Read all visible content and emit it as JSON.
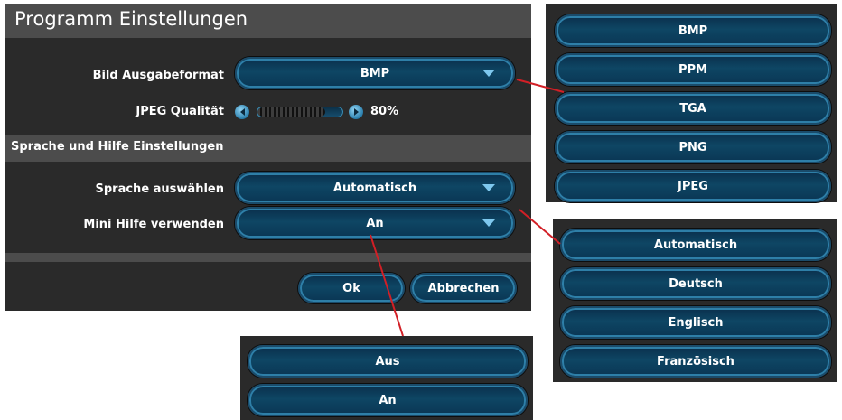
{
  "dialog": {
    "title": "Programm Einstellungen",
    "image_output_label": "Bild Ausgabeformat",
    "image_output_value": "BMP",
    "jpeg_quality_label": "JPEG Qualität",
    "jpeg_quality_value": "80%",
    "jpeg_quality_fraction": 0.8,
    "section_title": "Sprache und Hilfe Einstellungen",
    "language_label": "Sprache auswählen",
    "language_value": "Automatisch",
    "mini_help_label": "Mini Hilfe verwenden",
    "mini_help_value": "An",
    "ok_label": "Ok",
    "cancel_label": "Abbrechen"
  },
  "format_options": [
    "BMP",
    "PPM",
    "TGA",
    "PNG",
    "JPEG"
  ],
  "language_options": [
    "Automatisch",
    "Deutsch",
    "Englisch",
    "Französisch"
  ],
  "help_options": [
    "Aus",
    "An"
  ],
  "colors": {
    "panel_bg": "#2a2a2a",
    "header_bg": "#4c4c4c",
    "button_fill": "#0e4664",
    "button_edge": "#2e7fa8",
    "arrow": "#7ec8ee",
    "connector": "#d21f26"
  },
  "icons": {
    "dropdown": "chevron-down-icon",
    "slider_left": "arrow-left-icon",
    "slider_right": "arrow-right-icon"
  }
}
